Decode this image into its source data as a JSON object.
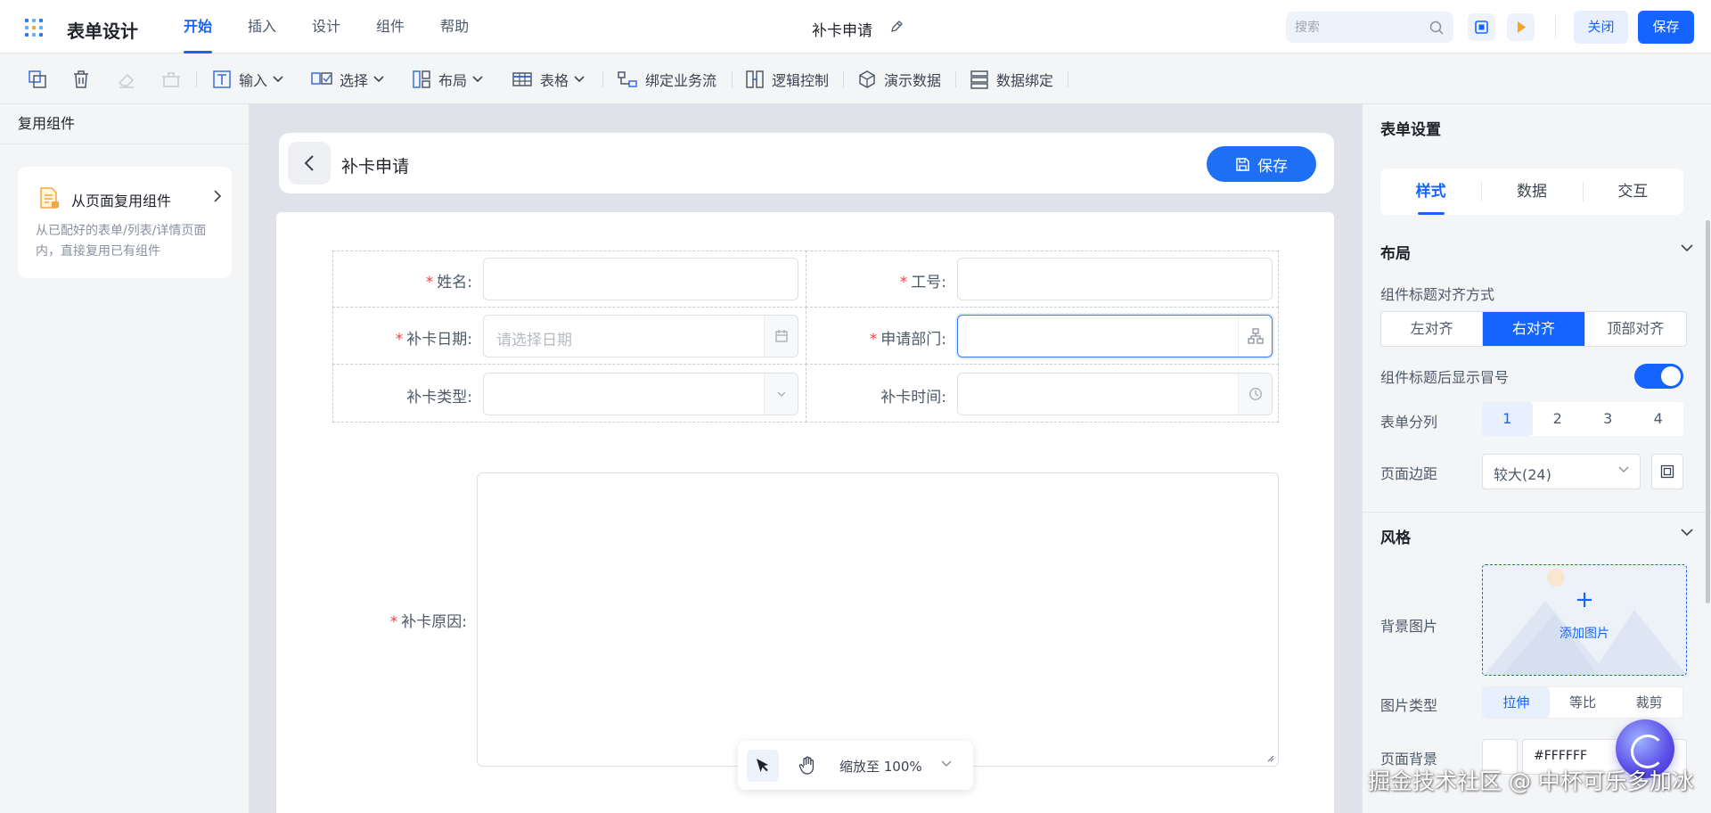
{
  "topbar": {
    "app_title": "表单设计",
    "tabs": [
      {
        "label": "开始",
        "active": true
      },
      {
        "label": "插入",
        "active": false
      },
      {
        "label": "设计",
        "active": false
      },
      {
        "label": "组件",
        "active": false
      },
      {
        "label": "帮助",
        "active": false
      }
    ],
    "doc_title": "补卡申请",
    "search_placeholder": "搜索",
    "close_label": "关闭",
    "save_label": "保存",
    "accent": "#1664ff"
  },
  "toolbar": {
    "input": "输入",
    "select": "选择",
    "layout": "布局",
    "table": "表格",
    "bind_flow": "绑定业务流",
    "logic": "逻辑控制",
    "demo_data": "演示数据",
    "data_bind": "数据绑定"
  },
  "left_panel": {
    "title": "复用组件",
    "card": {
      "title": "从页面复用组件",
      "desc": "从已配好的表单/列表/详情页面内，直接复用已有组件"
    }
  },
  "canvas": {
    "header_title": "补卡申请",
    "save_label": "保存",
    "fields": {
      "name": {
        "label": "姓名:",
        "required": true
      },
      "emp_no": {
        "label": "工号:",
        "required": true
      },
      "date": {
        "label": "补卡日期:",
        "required": true,
        "placeholder": "请选择日期"
      },
      "dept": {
        "label": "申请部门:",
        "required": true
      },
      "type": {
        "label": "补卡类型:",
        "required": false
      },
      "time": {
        "label": "补卡时间:",
        "required": false
      },
      "reason": {
        "label": "补卡原因:",
        "required": true
      }
    },
    "required_mark": "*",
    "zoom_label": "缩放至 100%"
  },
  "right_panel": {
    "title": "表单设置",
    "tabs": [
      {
        "label": "样式",
        "active": true
      },
      {
        "label": "数据",
        "active": false
      },
      {
        "label": "交互",
        "active": false
      }
    ],
    "layout_section": "布局",
    "label_align_title": "组件标题对齐方式",
    "align_options": [
      {
        "label": "左对齐",
        "active": false
      },
      {
        "label": "右对齐",
        "active": true
      },
      {
        "label": "顶部对齐",
        "active": false
      }
    ],
    "colon_label": "组件标题后显示冒号",
    "colon_on": true,
    "columns_label": "表单分列",
    "columns": [
      {
        "label": "1",
        "active": true
      },
      {
        "label": "2",
        "active": false
      },
      {
        "label": "3",
        "active": false
      },
      {
        "label": "4",
        "active": false
      }
    ],
    "margin_label": "页面边距",
    "margin_value": "较大(24)",
    "style_section": "风格",
    "bg_image_label": "背景图片",
    "add_image": "添加图片",
    "image_type_label": "图片类型",
    "image_types": [
      {
        "label": "拉伸",
        "active": true
      },
      {
        "label": "等比",
        "active": false
      },
      {
        "label": "裁剪",
        "active": false
      }
    ],
    "page_bg_label": "页面背景",
    "page_bg_value": "#FFFFFF"
  },
  "watermark": "掘金技术社区 @ 中杯可乐多加冰"
}
